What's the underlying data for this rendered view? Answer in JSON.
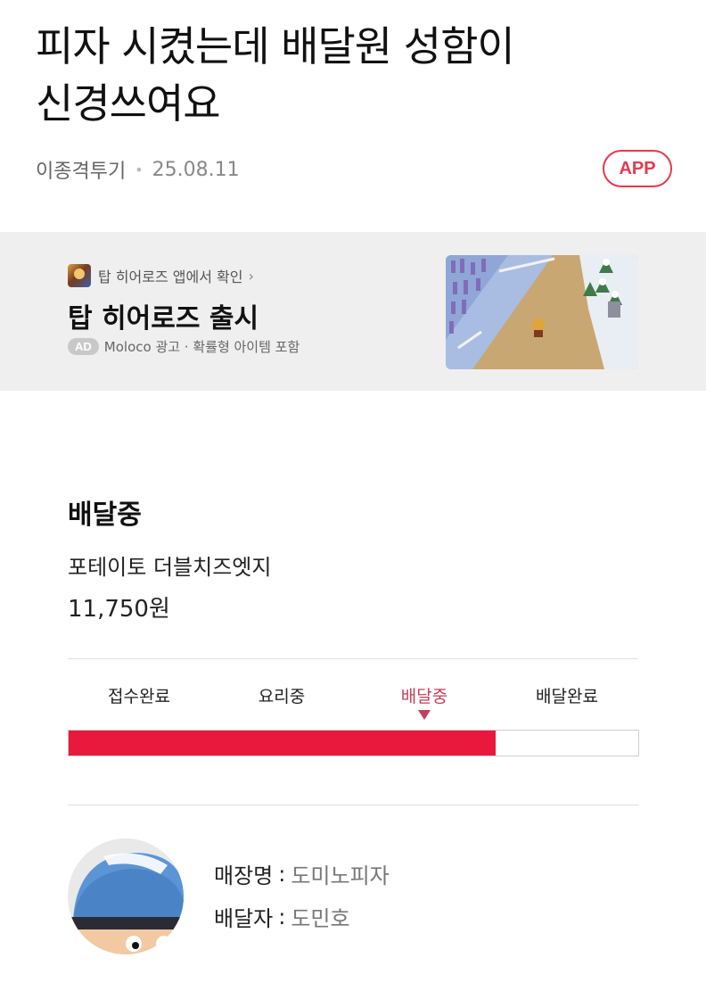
{
  "post": {
    "title_line1": "피자 시켰는데 배달원 성함이",
    "title_line2": "신경쓰여요",
    "board": "이종격투기",
    "date": "25.08.11",
    "app_button": "APP"
  },
  "ad": {
    "source": "탑 히어로즈 앱에서 확인",
    "chevron": "›",
    "title": "탑 히어로즈 출시",
    "badge": "AD",
    "sponsor": "Moloco 광고 · 확률형 아이템 포함"
  },
  "order": {
    "status": "배달중",
    "product": "포테이토 더블치즈엣지",
    "price": "11,750원",
    "steps": [
      "접수완료",
      "요리중",
      "배달중",
      "배달완료"
    ],
    "active_step_index": 2,
    "progress_percent": 75,
    "accent_color": "#e8193c"
  },
  "store": {
    "store_label": "매장명",
    "store_value": "도미노피자",
    "rider_label": "배달자",
    "rider_value": "도민호",
    "separator": ":"
  }
}
